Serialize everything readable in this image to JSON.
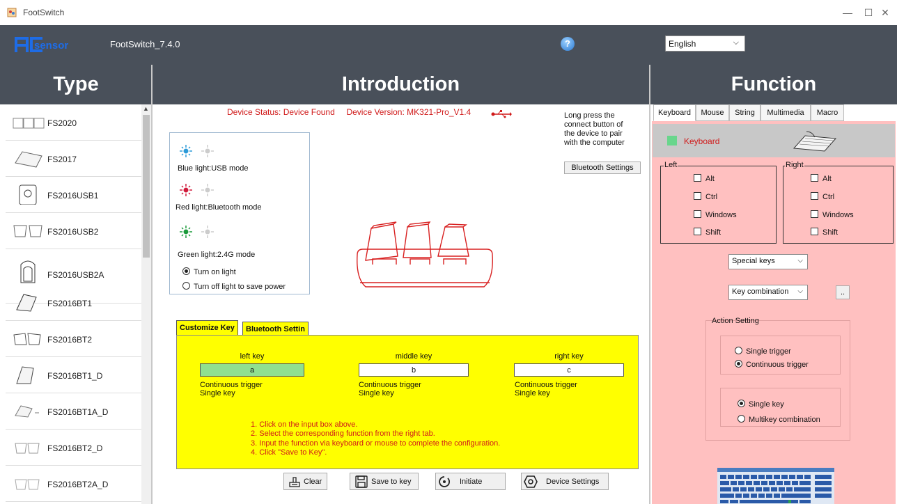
{
  "window": {
    "title": "FootSwitch",
    "minimize": "—",
    "maximize": "☐",
    "close": "✕"
  },
  "header": {
    "logo_text": "PCsensor",
    "version": "FootSwitch_7.4.0",
    "help": "?",
    "language": "English"
  },
  "columns": {
    "type": "Type",
    "introduction": "Introduction",
    "function": "Function"
  },
  "type_list": [
    {
      "label": "FS2020",
      "icon": "triple-pedal-icon"
    },
    {
      "label": "FS2017",
      "icon": "single-pedal-icon"
    },
    {
      "label": "FS2016USB1",
      "icon": "pedal-usb-icon"
    },
    {
      "label": "FS2016USB2",
      "icon": "double-pedal-icon"
    },
    {
      "label": "FS2016USB2A",
      "icon": "tall-pedal-icon"
    },
    {
      "label": "FS2016BT1",
      "icon": "bt-pedal-icon"
    },
    {
      "label": "FS2016BT2",
      "icon": "bt-double-pedal-icon"
    },
    {
      "label": "FS2016BT1_D",
      "icon": "bt-pedal-d-icon"
    },
    {
      "label": "FS2016BT1A_D",
      "icon": "bt-pedal-a-icon"
    },
    {
      "label": "FS2016BT2_D",
      "icon": "bt-double-pedal-d-icon"
    },
    {
      "label": "FS2016BT2A_D",
      "icon": "bt-double-pedal-a-icon"
    }
  ],
  "intro": {
    "device_status_label": "Device Status:",
    "device_status": "Device Found",
    "device_version_label": "Device Version:",
    "device_version": "MK321-Pro_V1.4",
    "pair_hint": "Long press the connect button of the device to pair with the computer",
    "bluetooth_settings": "Bluetooth Settings",
    "lights": [
      {
        "text": "Blue light:USB mode",
        "color": "#2a9ad8"
      },
      {
        "text": "Red light:Bluetooth mode",
        "color": "#d01a3a"
      },
      {
        "text": "Green light:2.4G mode",
        "color": "#1a9a3a"
      }
    ],
    "light_on": "Turn on light",
    "light_off": "Turn off light to save power",
    "tabs": [
      "Customize Key",
      "Bluetooth Settin"
    ],
    "keys": [
      {
        "header": "left key",
        "value": "a",
        "mode": "Continuous trigger",
        "type": "Single key"
      },
      {
        "header": "middle key",
        "value": "b",
        "mode": "Continuous trigger",
        "type": "Single key"
      },
      {
        "header": "right key",
        "value": "c",
        "mode": "Continuous trigger",
        "type": "Single key"
      }
    ],
    "steps": [
      "1. Click on the input box above.",
      "2. Select the corresponding function from the right tab.",
      "3. Input the function via keyboard or mouse to complete the configuration.",
      "4. Click \"Save to Key\"."
    ],
    "buttons": {
      "clear": "Clear",
      "save": "Save to key",
      "initiate": "Initiate",
      "device_settings": "Device Settings"
    }
  },
  "function": {
    "tabs": [
      "Keyboard",
      "Mouse",
      "String",
      "Multimedia",
      "Macro"
    ],
    "keyboard_label": "Keyboard",
    "left_label": "Left",
    "right_label": "Right",
    "modifiers": [
      "Alt",
      "Ctrl",
      "Windows",
      "Shift"
    ],
    "special_keys": "Special keys",
    "key_combination": "Key combination",
    "ellipsis": "..",
    "action_setting": "Action Setting",
    "single_trigger": "Single trigger",
    "continuous_trigger": "Continuous trigger",
    "single_key": "Single key",
    "multikey": "Multikey combination"
  },
  "colors": {
    "header_bg": "#49505a",
    "pink": "#ffc0c0",
    "yellow": "#ffff00",
    "status_red": "#d01a1a",
    "green_field": "#90e090"
  }
}
